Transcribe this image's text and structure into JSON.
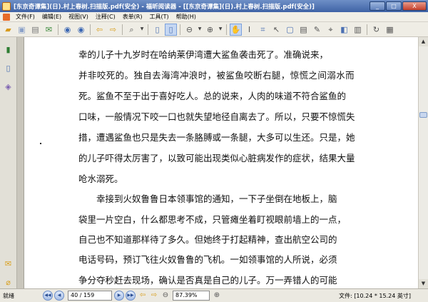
{
  "window": {
    "title": "[东京奇谭集](日).村上春树.扫描版.pdf(安全) - 福昕阅读器 - [[东京奇谭集](日).村上春树.扫描版.pdf(安全)]",
    "buttons": {
      "minimize": "_",
      "maximize": "□",
      "close": "X"
    }
  },
  "menu": [
    "文件(F)",
    "编辑(E)",
    "视图(V)",
    "注释(C)",
    "表单(R)",
    "工具(T)",
    "帮助(H)"
  ],
  "toolbar": {
    "icons": [
      "open-icon",
      "save-icon",
      "print-icon",
      "email-icon",
      "first-page-icon",
      "prev-page-icon",
      "back-icon",
      "forward-icon",
      "find-icon",
      "fit-page-icon",
      "fit-width-icon",
      "zoom-out-icon",
      "zoom-in-icon",
      "hand-tool-icon",
      "text-select-icon",
      "snapshot-icon",
      "typewriter-icon",
      "note-icon",
      "link-icon",
      "highlight-icon"
    ]
  },
  "document": {
    "paragraphs": [
      [
        "幸的儿子十九岁时在哈纳莱伊湾遭大鲨鱼袭击死了。准确说来，",
        "并非咬死的。独自去海湾冲浪时，被鲨鱼咬断右腿，惊慌之间溺水而",
        "死。鲨鱼不至于出于喜好吃人。总的说来，人肉的味道不符合鲨鱼的",
        "口味，一般情况下咬一口也就失望地径自离去了。所以，只要不惊慌失",
        "措，遭遇鲨鱼也只是失去一条胳膊或一条腿，大多可以生还。只是，她",
        "的儿子吓得太厉害了，以致可能出现类似心脏病发作的症状，结果大量",
        "呛水溺死。"
      ],
      [
        "幸接到火奴鲁鲁日本领事馆的通知，一下子坐倒在地板上，脑",
        "袋里一片空白，什么都思考不成，只管瘫坐着盯视眼前墙上的一点，",
        "自己也不知道那样待了多久。但她终于打起精神，查出航空公司的",
        "电话号码，预订飞往火奴鲁鲁的飞机。一如领事馆的人所说，必须",
        "争分夺秒赶去现场，确认是否真是自己的儿子。万一弄错人的可能"
      ]
    ]
  },
  "status": {
    "text": "就绪",
    "page_current": "40",
    "page_total": "159",
    "page_display": "40 / 159",
    "zoom": "87.39%",
    "file_size": "文件: [10.24 * 15.24 英寸]"
  }
}
